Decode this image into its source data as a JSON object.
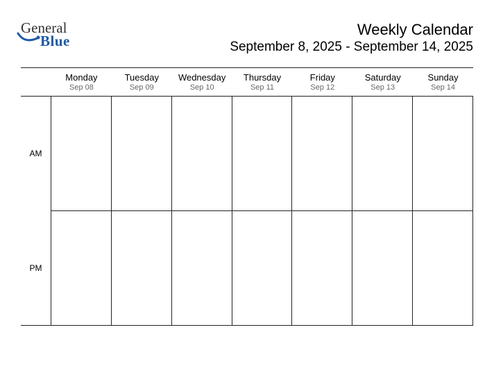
{
  "logo": {
    "top": "General",
    "bottom": "Blue",
    "color_primary": "#1f5aa6",
    "color_secondary": "#333333"
  },
  "header": {
    "title": "Weekly Calendar",
    "subtitle": "September 8, 2025 - September 14, 2025"
  },
  "time_labels": [
    "AM",
    "PM"
  ],
  "days": [
    {
      "name": "Monday",
      "date": "Sep 08"
    },
    {
      "name": "Tuesday",
      "date": "Sep 09"
    },
    {
      "name": "Wednesday",
      "date": "Sep 10"
    },
    {
      "name": "Thursday",
      "date": "Sep 11"
    },
    {
      "name": "Friday",
      "date": "Sep 12"
    },
    {
      "name": "Saturday",
      "date": "Sep 13"
    },
    {
      "name": "Sunday",
      "date": "Sep 14"
    }
  ]
}
